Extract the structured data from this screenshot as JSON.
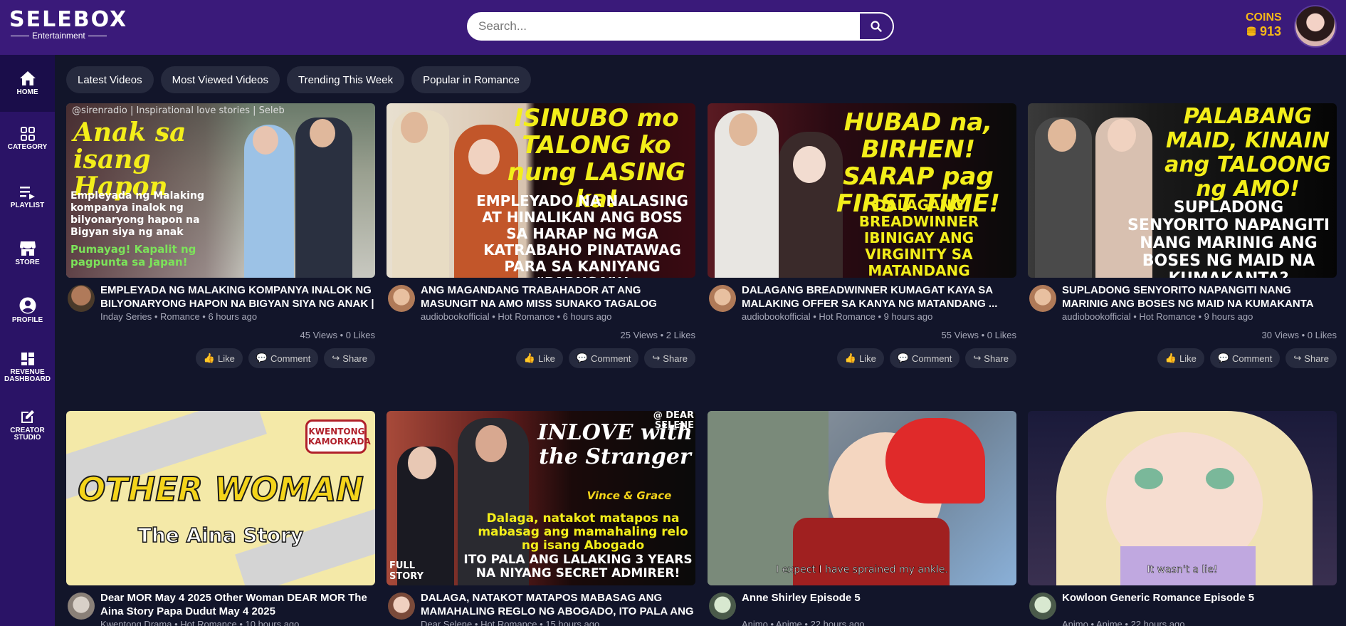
{
  "app": {
    "logo_main": "SELEBOX",
    "logo_sub": "Entertainment"
  },
  "search": {
    "placeholder": "Search..."
  },
  "coins": {
    "label": "COINS",
    "value": "913"
  },
  "sidebar": {
    "items": [
      {
        "label": "HOME",
        "icon": "home-icon"
      },
      {
        "label": "CATEGORY",
        "icon": "grid-icon"
      },
      {
        "label": "PLAYLIST",
        "icon": "playlist-icon"
      },
      {
        "label": "STORE",
        "icon": "store-icon"
      },
      {
        "label": "PROFILE",
        "icon": "user-icon"
      },
      {
        "label": "REVENUE DASHBOARD",
        "icon": "dashboard-icon"
      },
      {
        "label": "CREATOR STUDIO",
        "icon": "edit-icon"
      }
    ]
  },
  "tabs": [
    "Latest Videos",
    "Most Viewed Videos",
    "Trending This Week",
    "Popular in Romance"
  ],
  "actions": {
    "like": "Like",
    "comment": "Comment",
    "share": "Share"
  },
  "videos": [
    {
      "title": "EMPLEYADA NG MALAKING KOMPANYA INALOK NG BILYONARYONG HAPON NA BIGYAN SIYA NG ANAK | ...",
      "channel": "Inday Series",
      "category": "Romance",
      "time": "6 hours ago",
      "stats": "45 Views • 0 Likes",
      "thumb_lines": [
        "@sirenradio | Inspirational love stories | Seleb",
        "Anak sa isang Hapon",
        "Empleyada ng Malaking kompanya inalok ng bilyonaryong hapon na Bigyan siya ng anak",
        "Pumayag! Kapalit ng pagpunta sa Japan!"
      ]
    },
    {
      "title": "ANG MAGANDANG TRABAHADOR AT ANG MASUNGIT NA AMO MISS SUNAKO TAGALOG STORIES",
      "channel": "audiobookofficial",
      "category": "Hot Romance",
      "time": "6 hours ago",
      "stats": "25 Views • 2 Likes",
      "thumb_lines": [
        "ISINUBO mo TALONG ko nung LASING ka!",
        "EMPLEYADO NA NALASING AT HINALIKAN ANG BOSS SA HARAP NG MGA KATRABAHO PINATAWAG PARA SA KANIYANG “PARUSA”!!"
      ]
    },
    {
      "title": "DALAGANG BREADWINNER KUMAGAT KAYA SA MALAKING OFFER SA KANYA NG MATANDANG ...",
      "channel": "audiobookofficial",
      "category": "Hot Romance",
      "time": "9 hours ago",
      "stats": "55 Views • 0 Likes",
      "thumb_lines": [
        "HUBAD na, BIRHEN! SARAP pag FIRST TIME!",
        "DALAGANG BREADWINNER IBINIGAY ANG VIRGINITY SA MATANDANG BILYONARYO PARA SA KAGINHAWAAN!"
      ]
    },
    {
      "title": "SUPLADONG SENYORITO NAPANGITI NANG MARINIG ANG BOSES NG MAID NA KUMAKANTA MISS SUNAKO ...",
      "channel": "audiobookofficial",
      "category": "Hot Romance",
      "time": "9 hours ago",
      "stats": "30 Views • 0 Likes",
      "thumb_lines": [
        "PALABANG MAID, KINAIN ang TALOONG ng AMO!",
        "SUPLADONG SENYORITO NAPANGITI NANG MARINIG ANG BOSES NG MAID NA KUMAKANTA?"
      ]
    },
    {
      "title": "Dear MOR May 4 2025  Other Woman DEAR MOR The Aina Story Papa Dudut May 4 2025",
      "channel": "Kwentong Drama",
      "category": "Hot Romance",
      "time": "10 hours ago",
      "stats": "",
      "thumb_lines": [
        "KWENTONG KAMORKADA",
        "OTHER WOMAN",
        "The Aina Story"
      ]
    },
    {
      "title": "DALAGA, NATAKOT MATAPOS MABASAG ANG MAMAHALING REGLO NG ABOGADO, ITO PALA ANG ...",
      "channel": "Dear Selene",
      "category": "Hot Romance",
      "time": "15 hours ago",
      "stats": "",
      "thumb_lines": [
        "@ DEAR SELENE",
        "INLOVE with the Stranger",
        "Vince & Grace",
        "Dalaga, natakot matapos na mabasag ang mamahaling relo ng isang Abogado",
        "ITO PALA ANG LALAKING 3 YEARS NA NIYANG SECRET ADMIRER!",
        "FULL STORY"
      ]
    },
    {
      "title": "Anne Shirley Episode 5",
      "channel": "Animo",
      "category": "Anime",
      "time": "22 hours ago",
      "stats": "",
      "thumb_lines": [
        "I expect I have sprained my ankle."
      ]
    },
    {
      "title": "Kowloon Generic Romance Episode 5",
      "channel": "Animo",
      "category": "Anime",
      "time": "22 hours ago",
      "stats": "",
      "thumb_lines": [
        "It wasn't a lie!"
      ]
    }
  ]
}
